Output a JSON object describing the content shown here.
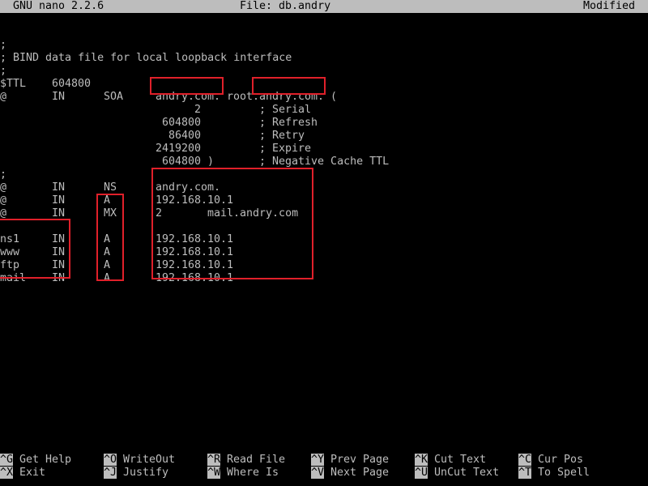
{
  "titlebar": {
    "app": "GNU nano 2.2.6",
    "file": "File: db.andry",
    "status": "Modified"
  },
  "editor": {
    "comment1": ";",
    "comment2": "; BIND data file for local loopback interface",
    "comment3": ";",
    "ttl_key": "$TTL",
    "ttl_val": "604800",
    "soa": {
      "name": "@",
      "class": "IN",
      "type": "SOA",
      "mname": "andry.com.",
      "rname_prefix": "root",
      "rname_domain": ".andry.com.",
      "open": "("
    },
    "soa_fields": [
      {
        "value": "2",
        "comment": "; Serial"
      },
      {
        "value": "604800",
        "comment": "; Refresh"
      },
      {
        "value": "86400",
        "comment": "; Retry"
      },
      {
        "value": "2419200",
        "comment": "; Expire"
      },
      {
        "value": "604800 )",
        "comment": "; Negative Cache TTL"
      }
    ],
    "comment4": ";",
    "records": [
      {
        "name": "@",
        "class": "IN",
        "type": "NS",
        "data": "andry.com."
      },
      {
        "name": "@",
        "class": "IN",
        "type": "A",
        "data": "192.168.10.1"
      },
      {
        "name": "@",
        "class": "IN",
        "type": "MX",
        "pref": "2",
        "data": "mail.andry.com"
      },
      {
        "name": "ns1",
        "class": "IN",
        "type": "A",
        "data": "192.168.10.1"
      },
      {
        "name": "www",
        "class": "IN",
        "type": "A",
        "data": "192.168.10.1"
      },
      {
        "name": "ftp",
        "class": "IN",
        "type": "A",
        "data": "192.168.10.1"
      },
      {
        "name": "mail",
        "class": "IN",
        "type": "A",
        "data": "192.168.10.1"
      }
    ]
  },
  "shortcuts": [
    {
      "key": "^G",
      "label": "Get Help"
    },
    {
      "key": "^X",
      "label": "Exit"
    },
    {
      "key": "^O",
      "label": "WriteOut"
    },
    {
      "key": "^J",
      "label": "Justify"
    },
    {
      "key": "^R",
      "label": "Read File"
    },
    {
      "key": "^W",
      "label": "Where Is"
    },
    {
      "key": "^Y",
      "label": "Prev Page"
    },
    {
      "key": "^V",
      "label": "Next Page"
    },
    {
      "key": "^K",
      "label": "Cut Text"
    },
    {
      "key": "^U",
      "label": "UnCut Text"
    },
    {
      "key": "^C",
      "label": "Cur Pos"
    },
    {
      "key": "^T",
      "label": "To Spell"
    }
  ],
  "colors": {
    "background": "#000000",
    "text": "#bdbdbd",
    "highlight_box": "#e0202a"
  }
}
